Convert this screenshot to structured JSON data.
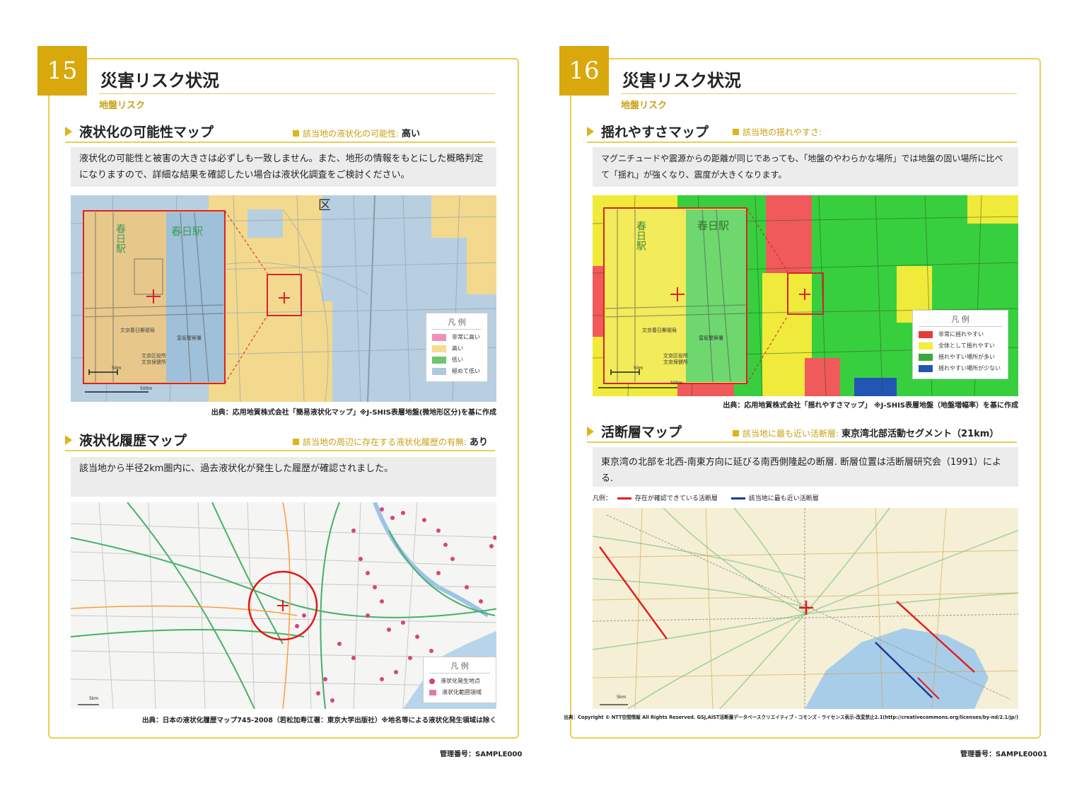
{
  "page15": {
    "number": "15",
    "title": "災害リスク状況",
    "subtitle": "地盤リスク",
    "liq": {
      "heading": "液状化の可能性マップ",
      "info_label": "該当地の液状化の可能性:",
      "info_value": "高い",
      "description": "液状化の可能性と被害の大きさは必ずしも一致しません。また、地形の情報をもとにした概略判定になりますので、詳細な結果を確認したい場合は液状化調査をご検討ください。",
      "legend": {
        "title": "凡 例",
        "items": [
          {
            "label": "非常に高い",
            "color": "#f090b8"
          },
          {
            "label": "高い",
            "color": "#f6dc8e"
          },
          {
            "label": "低い",
            "color": "#6fc46f"
          },
          {
            "label": "極めて低い",
            "color": "#aec8dc"
          }
        ]
      },
      "map_labels": {
        "station1": "春日駅",
        "station2": "春日駅",
        "post": "文京春日郵便局",
        "police": "富坂警察署",
        "ward": "文京区役所",
        "ward2": "文京保健所",
        "scale_small": "50m",
        "scale_big": "500m",
        "ku": "区"
      },
      "source": "出典：応用地質株式会社「簡易液状化マップ」※J-SHIS表層地盤(微地形区分)を基に作成"
    },
    "history": {
      "heading": "液状化履歴マップ",
      "info_label": "該当地の周辺に存在する液状化履歴の有無:",
      "info_value": "あり",
      "description": "該当地から半径2km圏内に、過去液状化が発生した履歴が確認されました。",
      "legend": {
        "title": "凡 例",
        "items": [
          {
            "label": "液状化発生地点",
            "color": "#d2437c"
          },
          {
            "label": "液状化範囲領域",
            "color": "#e07aa8"
          }
        ]
      },
      "scale": "5km",
      "source": "出典：日本の液状化履歴マップ745-2008（若松加寿江著：東京大学出版社）※地名等による液状化発生領域は除く"
    },
    "management": "管理番号：SAMPLE000"
  },
  "page16": {
    "number": "16",
    "title": "災害リスク状況",
    "subtitle": "地盤リスク",
    "shake": {
      "heading": "揺れやすさマップ",
      "info_label": "該当地の揺れやすさ:",
      "info_value": "",
      "description": "マグニチュードや震源からの距離が同じであっても、「地盤のやわらかな場所」では地盤の固い場所に比べて「揺れ」が強くなり、震度が大きくなります。",
      "legend": {
        "title": "凡 例",
        "items": [
          {
            "label": "非常に揺れやすい",
            "color": "#e83a3a"
          },
          {
            "label": "全体として揺れやすい",
            "color": "#f2ee3a"
          },
          {
            "label": "揺れやすい場所が多い",
            "color": "#3aa83a"
          },
          {
            "label": "揺れやすい場所が少ない",
            "color": "#2356b4"
          }
        ]
      },
      "map_labels": {
        "station1": "春日駅",
        "station2": "春日駅",
        "post": "文京春日郵便局",
        "police": "富坂警察署",
        "ward": "文京区役所",
        "ward2": "文京保健所",
        "scale_small": "50m",
        "scale_big": "500m"
      },
      "source": "出典：応用地質株式会社「揺れやすさマップ」 ※J-SHIS表層地盤（地盤増幅率）を基に作成"
    },
    "fault": {
      "heading": "活断層マップ",
      "info_label": "該当地に最も近い活断層:",
      "info_value": "東京湾北部活動セグメント（21km）",
      "description": "東京湾の北部を北西-南東方向に延びる南西側隆起の断層. 断層位置は活断層研究会（1991）による.",
      "legend_label": "凡例：",
      "legend_items": [
        {
          "label": "存在が確認できている活断層",
          "color": "#e02020"
        },
        {
          "label": "該当地に最も近い活断層",
          "color": "#1a3a9a"
        }
      ],
      "scale": "5km",
      "source": "出典：Copyright © NTT空間情報 All Rights Reserved. GSJ,AIST活断層データベースクリエイティブ・コモンズ・ライセンス表示-改変禁止2.1(http://creativecommons.org/licenses/by-nd/2.1/jp/)"
    },
    "management": "管理番号：SAMPLE0001"
  }
}
